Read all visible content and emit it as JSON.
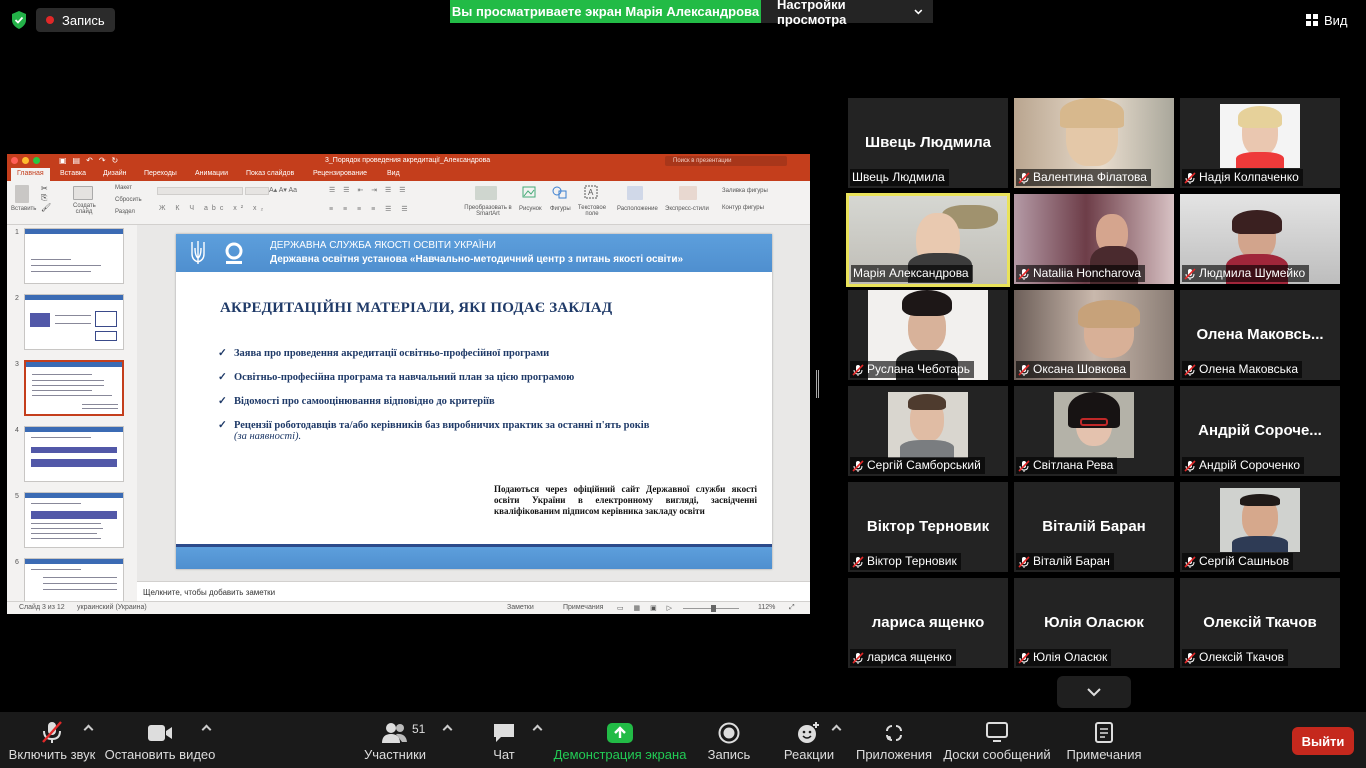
{
  "topbar": {
    "record_label": "Запись",
    "viewing_banner": "Вы просматриваете экран Марія Александрова",
    "view_settings_label": "Настройки просмотра",
    "view_label": "Вид"
  },
  "ppt": {
    "window_title": "3_Порядок проведения акредитації_Александрова",
    "search_placeholder": "Поиск в презентации",
    "tabs": [
      "Главная",
      "Вставка",
      "Дизайн",
      "Переходы",
      "Анимации",
      "Показ слайдов",
      "Рецензирование",
      "Вид"
    ],
    "ribbon": {
      "paste": "Вставить",
      "new_slide": "Создать слайд",
      "layout": "Макет",
      "reset": "Сбросить",
      "section": "Раздел",
      "smartart": "Преобразовать в SmartArt",
      "picture": "Рисунок",
      "shapes": "Фигуры",
      "textbox": "Текстовое поле",
      "arrange": "Расположение",
      "quick_styles": "Экспресс-стили",
      "shape_fill": "Заливка фигуры",
      "shape_outline": "Контур фигуры"
    },
    "thumbnail_numbers": [
      "1",
      "2",
      "3",
      "4",
      "5",
      "6"
    ],
    "slide": {
      "header_line1": "ДЕРЖАВНА СЛУЖБА ЯКОСТІ ОСВІТИ УКРАЇНИ",
      "header_line2": "Державна освітня установа «Навчально-методичний центр з питань якості освіти»",
      "title": "АКРЕДИТАЦІЙНІ МАТЕРІАЛИ, ЯКІ ПОДАЄ ЗАКЛАД",
      "bullets": [
        "Заява про проведення акредитації освітньо-професійної програми",
        "Освітньо-професійна програма та навчальний план за цією програмою",
        "Відомості про самооцінювання відповідно до критеріїв",
        "Рецензії роботодавців та/або керівників баз виробничих практик за останні п'ять років"
      ],
      "bullet4_sub": "(за наявності).",
      "note": "Подаються через офіційний сайт Державної служби якості освіти України в електронному вигляді, засвідченні кваліфікованим підписом керівника закладу освіти"
    },
    "notes_placeholder": "Щелкните, чтобы добавить заметки",
    "status": {
      "slide_count": "Слайд 3 из 12",
      "language": "украинский (Украина)",
      "notes": "Заметки",
      "comments": "Примечания",
      "zoom": "112%"
    }
  },
  "gallery": {
    "tiles": [
      {
        "name": "Швець Людмила",
        "big": "Швець Людмила",
        "muted": false
      },
      {
        "name": "Валентина Філатова",
        "muted": true
      },
      {
        "name": "Надія Колпаченко",
        "muted": true
      },
      {
        "name": "Марія Александрова",
        "muted": false
      },
      {
        "name": "Nataliia Honcharova",
        "muted": true
      },
      {
        "name": "Людмила Шумейко",
        "muted": true
      },
      {
        "name": "Руслана Чеботарь",
        "muted": true
      },
      {
        "name": "Оксана Шовкова",
        "muted": true
      },
      {
        "name": "Олена Маковська",
        "big": "Олена  Маковсь...",
        "muted": true
      },
      {
        "name": "Сергій Самборський",
        "muted": true
      },
      {
        "name": "Світлана Рева",
        "muted": true
      },
      {
        "name": "Андрій Сороченко",
        "big": "Андрій  Сороче...",
        "muted": true
      },
      {
        "name": "Віктор Терновик",
        "big": "Віктор Терновик",
        "muted": true
      },
      {
        "name": "Віталій Баран",
        "big": "Віталій Баран",
        "muted": true
      },
      {
        "name": "Сергій Сашньов",
        "muted": true
      },
      {
        "name": "лариса ященко",
        "big": "лариса ященко",
        "muted": true
      },
      {
        "name": "Юлія Оласюк",
        "big": "Юлія Оласюк",
        "muted": true
      },
      {
        "name": "Олексій Ткачов",
        "big": "Олексій Ткачов",
        "muted": true
      }
    ]
  },
  "toolbar": {
    "unmute": "Включить звук",
    "stop_video": "Остановить видео",
    "participants": "Участники",
    "participants_count": "51",
    "chat": "Чат",
    "share_screen": "Демонстрация экрана",
    "record": "Запись",
    "reactions": "Реакции",
    "apps": "Приложения",
    "whiteboards": "Доски сообщений",
    "notes": "Примечания",
    "leave": "Выйти"
  },
  "colors": {
    "share_green": "#22bb46",
    "leave_red": "#c5281d",
    "ppt_accent": "#c43e1c",
    "active_speaker": "#e9e25a"
  }
}
